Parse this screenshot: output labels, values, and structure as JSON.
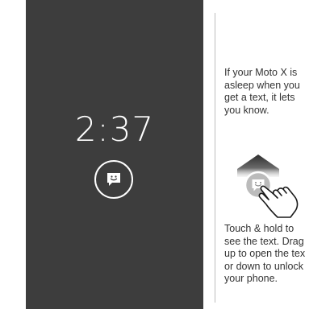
{
  "lock_screen": {
    "time": "2:37",
    "notification_icon": "smiley-message-icon"
  },
  "instructions": {
    "top_text": "If your Moto X is\nasleep when you\nget a text, it lets\nyou know.",
    "bottom_text": "Touch & hold to\nsee the text. Drag\nup to open the tex\nor down to unlock\nyour phone.",
    "illustration_icons": [
      "up-arrow-icon",
      "smiley-message-icon",
      "hand-pointer-icon"
    ]
  },
  "colors": {
    "screen_background": "#3d3d3d",
    "page_background": "#ffffff",
    "text": "#333333",
    "divider": "#bdbdbd"
  }
}
